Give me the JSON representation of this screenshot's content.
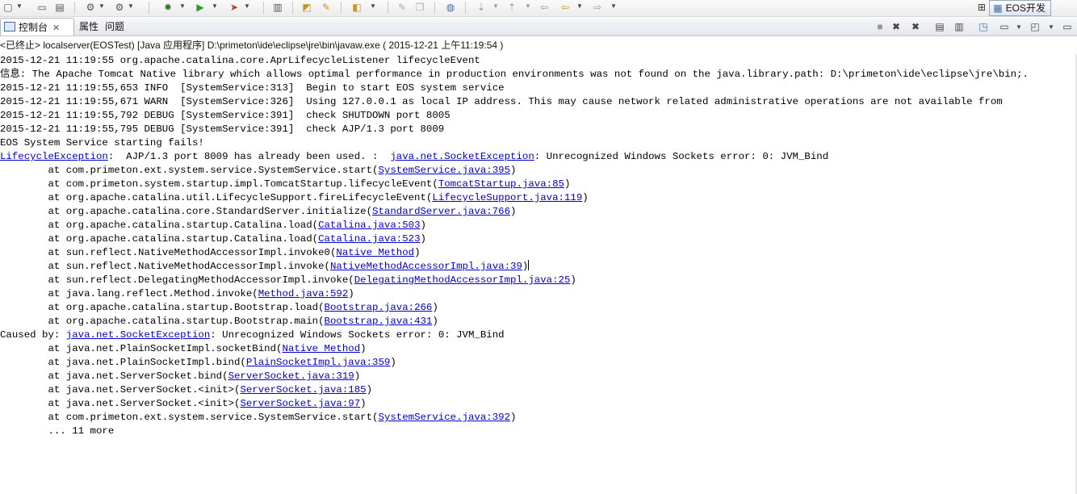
{
  "toolbar": {
    "perspective_label": "EOS开发",
    "icons": [
      "new-icon",
      "save-icon",
      "print-icon",
      "server-icon",
      "settings-icon",
      "debug-icon",
      "run-icon",
      "external-tools-icon",
      "book-icon",
      "open-folder-icon",
      "wand-icon",
      "new-file-icon",
      "pencil-icon",
      "copy-icon",
      "globe-icon",
      "annotation-icon",
      "up-icon",
      "back-icon",
      "forward-icon"
    ]
  },
  "tabs": {
    "console": "控制台",
    "properties": "属性",
    "problems": "问题",
    "close_glyph": "✕"
  },
  "process": {
    "label": "<已终止> localserver(EOSTest) [Java 应用程序] D:\\primeton\\ide\\eclipse\\jre\\bin\\javaw.exe ( 2015-12-21 上午11:19:54 )"
  },
  "console": {
    "lines": [
      {
        "segments": [
          {
            "t": "2015-12-21 11:19:55 org.apache.catalina.core.AprLifecycleListener lifecycleEvent"
          }
        ]
      },
      {
        "segments": [
          {
            "t": "信息: The Apache Tomcat Native library which allows optimal performance in production environments was not found on the java.library.path: D:\\primeton\\ide\\eclipse\\jre\\bin;."
          }
        ]
      },
      {
        "segments": [
          {
            "t": "2015-12-21 11:19:55,653 INFO  [SystemService:313]  Begin to start EOS system service"
          }
        ]
      },
      {
        "segments": [
          {
            "t": "2015-12-21 11:19:55,671 WARN  [SystemService:326]  Using 127.0.0.1 as local IP address. This may cause network related administrative operations are not available from"
          }
        ]
      },
      {
        "segments": [
          {
            "t": "2015-12-21 11:19:55,792 DEBUG [SystemService:391]  check SHUTDOWN port 8005"
          }
        ]
      },
      {
        "segments": [
          {
            "t": "2015-12-21 11:19:55,795 DEBUG [SystemService:391]  check AJP/1.3 port 8009"
          }
        ]
      },
      {
        "segments": [
          {
            "t": "EOS System Service starting fails!"
          }
        ]
      },
      {
        "segments": [
          {
            "t": "LifecycleException",
            "link": true
          },
          {
            "t": ":  AJP/1.3 port 8009 has already been used. :  "
          },
          {
            "t": "java.net.SocketException",
            "link": true
          },
          {
            "t": ": Unrecognized Windows Sockets error: 0: JVM_Bind"
          }
        ]
      },
      {
        "segments": [
          {
            "t": "        at com.primeton.ext.system.service.SystemService.start("
          },
          {
            "t": "SystemService.java:395",
            "link": true
          },
          {
            "t": ")"
          }
        ]
      },
      {
        "segments": [
          {
            "t": "        at com.primeton.system.startup.impl.TomcatStartup.lifecycleEvent("
          },
          {
            "t": "TomcatStartup.java:85",
            "link": true
          },
          {
            "t": ")"
          }
        ]
      },
      {
        "segments": [
          {
            "t": "        at org.apache.catalina.util.LifecycleSupport.fireLifecycleEvent("
          },
          {
            "t": "LifecycleSupport.java:119",
            "link": true
          },
          {
            "t": ")"
          }
        ]
      },
      {
        "segments": [
          {
            "t": "        at org.apache.catalina.core.StandardServer.initialize("
          },
          {
            "t": "StandardServer.java:766",
            "link": true
          },
          {
            "t": ")"
          }
        ]
      },
      {
        "segments": [
          {
            "t": "        at org.apache.catalina.startup.Catalina.load("
          },
          {
            "t": "Catalina.java:503",
            "link": true
          },
          {
            "t": ")"
          }
        ]
      },
      {
        "segments": [
          {
            "t": "        at org.apache.catalina.startup.Catalina.load("
          },
          {
            "t": "Catalina.java:523",
            "link": true
          },
          {
            "t": ")"
          }
        ]
      },
      {
        "segments": [
          {
            "t": "        at sun.reflect.NativeMethodAccessorImpl.invoke0("
          },
          {
            "t": "Native Method",
            "link": true
          },
          {
            "t": ")"
          }
        ]
      },
      {
        "segments": [
          {
            "t": "        at sun.reflect.NativeMethodAccessorImpl.invoke("
          },
          {
            "t": "NativeMethodAccessorImpl.java:39",
            "link": true
          },
          {
            "t": ")"
          }
        ],
        "cursor": true
      },
      {
        "segments": [
          {
            "t": "        at sun.reflect.DelegatingMethodAccessorImpl.invoke("
          },
          {
            "t": "DelegatingMethodAccessorImpl.java:25",
            "link": true
          },
          {
            "t": ")"
          }
        ]
      },
      {
        "segments": [
          {
            "t": "        at java.lang.reflect.Method.invoke("
          },
          {
            "t": "Method.java:592",
            "link": true
          },
          {
            "t": ")"
          }
        ]
      },
      {
        "segments": [
          {
            "t": "        at org.apache.catalina.startup.Bootstrap.load("
          },
          {
            "t": "Bootstrap.java:266",
            "link": true
          },
          {
            "t": ")"
          }
        ]
      },
      {
        "segments": [
          {
            "t": "        at org.apache.catalina.startup.Bootstrap.main("
          },
          {
            "t": "Bootstrap.java:431",
            "link": true
          },
          {
            "t": ")"
          }
        ]
      },
      {
        "segments": [
          {
            "t": "Caused by: "
          },
          {
            "t": "java.net.SocketException",
            "link": true
          },
          {
            "t": ": Unrecognized Windows Sockets error: 0: JVM_Bind"
          }
        ]
      },
      {
        "segments": [
          {
            "t": "        at java.net.PlainSocketImpl.socketBind("
          },
          {
            "t": "Native Method",
            "link": true
          },
          {
            "t": ")"
          }
        ]
      },
      {
        "segments": [
          {
            "t": "        at java.net.PlainSocketImpl.bind("
          },
          {
            "t": "PlainSocketImpl.java:359",
            "link": true
          },
          {
            "t": ")"
          }
        ]
      },
      {
        "segments": [
          {
            "t": "        at java.net.ServerSocket.bind("
          },
          {
            "t": "ServerSocket.java:319",
            "link": true
          },
          {
            "t": ")"
          }
        ]
      },
      {
        "segments": [
          {
            "t": "        at java.net.ServerSocket.<init>("
          },
          {
            "t": "ServerSocket.java:185",
            "link": true
          },
          {
            "t": ")"
          }
        ]
      },
      {
        "segments": [
          {
            "t": "        at java.net.ServerSocket.<init>("
          },
          {
            "t": "ServerSocket.java:97",
            "link": true
          },
          {
            "t": ")"
          }
        ]
      },
      {
        "segments": [
          {
            "t": "        at com.primeton.ext.system.service.SystemService.start("
          },
          {
            "t": "SystemService.java:392",
            "link": true
          },
          {
            "t": ")"
          }
        ]
      },
      {
        "segments": [
          {
            "t": "        ... 11 more"
          }
        ]
      }
    ]
  }
}
